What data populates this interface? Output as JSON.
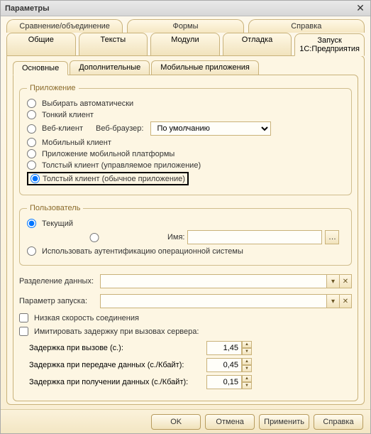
{
  "window": {
    "title": "Параметры"
  },
  "tabs_row1": [
    "Сравнение/объединение",
    "Формы",
    "Справка"
  ],
  "tabs_row2": [
    "Общие",
    "Тексты",
    "Модули",
    "Отладка",
    "Запуск 1С:Предприятия"
  ],
  "tabs_row2_active_index": 4,
  "subtabs": [
    "Основные",
    "Дополнительные",
    "Мобильные приложения"
  ],
  "subtabs_active_index": 0,
  "app_group": {
    "legend": "Приложение",
    "options": {
      "auto": "Выбирать автоматически",
      "thin": "Тонкий клиент",
      "web": "Веб-клиент",
      "web_browser_label": "Веб-браузер:",
      "web_browser_value": "По умолчанию",
      "mobile_client": "Мобильный клиент",
      "mobile_platform": "Приложение мобильной платформы",
      "thick_managed": "Толстый клиент (управляемое приложение)",
      "thick_ordinary": "Толстый клиент (обычное приложение)"
    },
    "selected": "thick_ordinary"
  },
  "user_group": {
    "legend": "Пользователь",
    "current": "Текущий",
    "name_label": "Имя:",
    "name_value": "",
    "os_auth": "Использовать аутентификацию операционной системы",
    "selected": "current"
  },
  "data_sep": {
    "label": "Разделение данных:",
    "value": ""
  },
  "launch_param": {
    "label": "Параметр запуска:",
    "value": ""
  },
  "slow_conn": "Низкая скорость соединения",
  "simulate_delay": {
    "label": "Имитировать задержку при вызовах сервера:",
    "call": {
      "label": "Задержка при вызове (с.):",
      "value": "1,45"
    },
    "send": {
      "label": "Задержка при передаче данных (с./Кбайт):",
      "value": "0,45"
    },
    "recv": {
      "label": "Задержка при получении данных (с./Кбайт):",
      "value": "0,15"
    }
  },
  "footer": {
    "ok": "OK",
    "cancel": "Отмена",
    "apply": "Применить",
    "help": "Справка"
  }
}
